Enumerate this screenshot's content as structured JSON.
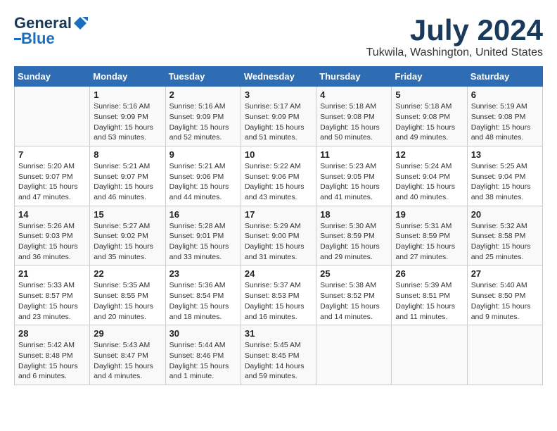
{
  "header": {
    "logo_general": "General",
    "logo_blue": "Blue",
    "title": "July 2024",
    "subtitle": "Tukwila, Washington, United States"
  },
  "calendar": {
    "days_of_week": [
      "Sunday",
      "Monday",
      "Tuesday",
      "Wednesday",
      "Thursday",
      "Friday",
      "Saturday"
    ],
    "weeks": [
      [
        {
          "num": "",
          "info": ""
        },
        {
          "num": "1",
          "info": "Sunrise: 5:16 AM\nSunset: 9:09 PM\nDaylight: 15 hours\nand 53 minutes."
        },
        {
          "num": "2",
          "info": "Sunrise: 5:16 AM\nSunset: 9:09 PM\nDaylight: 15 hours\nand 52 minutes."
        },
        {
          "num": "3",
          "info": "Sunrise: 5:17 AM\nSunset: 9:09 PM\nDaylight: 15 hours\nand 51 minutes."
        },
        {
          "num": "4",
          "info": "Sunrise: 5:18 AM\nSunset: 9:08 PM\nDaylight: 15 hours\nand 50 minutes."
        },
        {
          "num": "5",
          "info": "Sunrise: 5:18 AM\nSunset: 9:08 PM\nDaylight: 15 hours\nand 49 minutes."
        },
        {
          "num": "6",
          "info": "Sunrise: 5:19 AM\nSunset: 9:08 PM\nDaylight: 15 hours\nand 48 minutes."
        }
      ],
      [
        {
          "num": "7",
          "info": "Sunrise: 5:20 AM\nSunset: 9:07 PM\nDaylight: 15 hours\nand 47 minutes."
        },
        {
          "num": "8",
          "info": "Sunrise: 5:21 AM\nSunset: 9:07 PM\nDaylight: 15 hours\nand 46 minutes."
        },
        {
          "num": "9",
          "info": "Sunrise: 5:21 AM\nSunset: 9:06 PM\nDaylight: 15 hours\nand 44 minutes."
        },
        {
          "num": "10",
          "info": "Sunrise: 5:22 AM\nSunset: 9:06 PM\nDaylight: 15 hours\nand 43 minutes."
        },
        {
          "num": "11",
          "info": "Sunrise: 5:23 AM\nSunset: 9:05 PM\nDaylight: 15 hours\nand 41 minutes."
        },
        {
          "num": "12",
          "info": "Sunrise: 5:24 AM\nSunset: 9:04 PM\nDaylight: 15 hours\nand 40 minutes."
        },
        {
          "num": "13",
          "info": "Sunrise: 5:25 AM\nSunset: 9:04 PM\nDaylight: 15 hours\nand 38 minutes."
        }
      ],
      [
        {
          "num": "14",
          "info": "Sunrise: 5:26 AM\nSunset: 9:03 PM\nDaylight: 15 hours\nand 36 minutes."
        },
        {
          "num": "15",
          "info": "Sunrise: 5:27 AM\nSunset: 9:02 PM\nDaylight: 15 hours\nand 35 minutes."
        },
        {
          "num": "16",
          "info": "Sunrise: 5:28 AM\nSunset: 9:01 PM\nDaylight: 15 hours\nand 33 minutes."
        },
        {
          "num": "17",
          "info": "Sunrise: 5:29 AM\nSunset: 9:00 PM\nDaylight: 15 hours\nand 31 minutes."
        },
        {
          "num": "18",
          "info": "Sunrise: 5:30 AM\nSunset: 8:59 PM\nDaylight: 15 hours\nand 29 minutes."
        },
        {
          "num": "19",
          "info": "Sunrise: 5:31 AM\nSunset: 8:59 PM\nDaylight: 15 hours\nand 27 minutes."
        },
        {
          "num": "20",
          "info": "Sunrise: 5:32 AM\nSunset: 8:58 PM\nDaylight: 15 hours\nand 25 minutes."
        }
      ],
      [
        {
          "num": "21",
          "info": "Sunrise: 5:33 AM\nSunset: 8:57 PM\nDaylight: 15 hours\nand 23 minutes."
        },
        {
          "num": "22",
          "info": "Sunrise: 5:35 AM\nSunset: 8:55 PM\nDaylight: 15 hours\nand 20 minutes."
        },
        {
          "num": "23",
          "info": "Sunrise: 5:36 AM\nSunset: 8:54 PM\nDaylight: 15 hours\nand 18 minutes."
        },
        {
          "num": "24",
          "info": "Sunrise: 5:37 AM\nSunset: 8:53 PM\nDaylight: 15 hours\nand 16 minutes."
        },
        {
          "num": "25",
          "info": "Sunrise: 5:38 AM\nSunset: 8:52 PM\nDaylight: 15 hours\nand 14 minutes."
        },
        {
          "num": "26",
          "info": "Sunrise: 5:39 AM\nSunset: 8:51 PM\nDaylight: 15 hours\nand 11 minutes."
        },
        {
          "num": "27",
          "info": "Sunrise: 5:40 AM\nSunset: 8:50 PM\nDaylight: 15 hours\nand 9 minutes."
        }
      ],
      [
        {
          "num": "28",
          "info": "Sunrise: 5:42 AM\nSunset: 8:48 PM\nDaylight: 15 hours\nand 6 minutes."
        },
        {
          "num": "29",
          "info": "Sunrise: 5:43 AM\nSunset: 8:47 PM\nDaylight: 15 hours\nand 4 minutes."
        },
        {
          "num": "30",
          "info": "Sunrise: 5:44 AM\nSunset: 8:46 PM\nDaylight: 15 hours\nand 1 minute."
        },
        {
          "num": "31",
          "info": "Sunrise: 5:45 AM\nSunset: 8:45 PM\nDaylight: 14 hours\nand 59 minutes."
        },
        {
          "num": "",
          "info": ""
        },
        {
          "num": "",
          "info": ""
        },
        {
          "num": "",
          "info": ""
        }
      ]
    ]
  }
}
